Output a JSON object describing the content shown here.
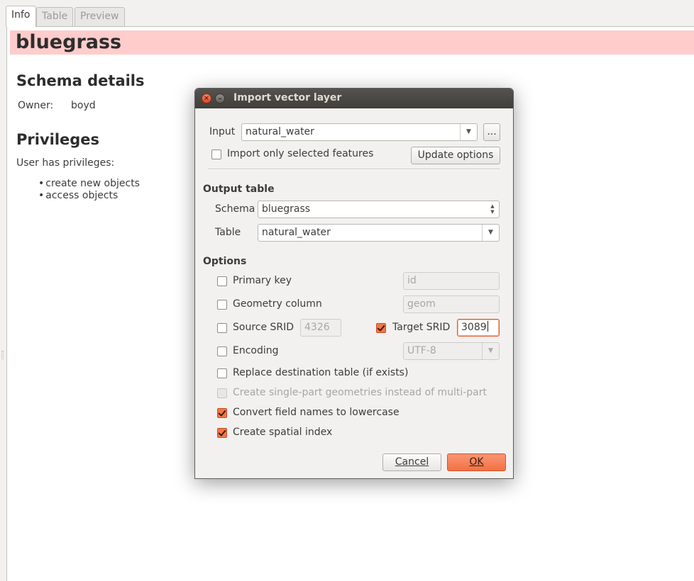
{
  "tabs": [
    {
      "label": "Info",
      "active": true
    },
    {
      "label": "Table",
      "active": false
    },
    {
      "label": "Preview",
      "active": false
    }
  ],
  "page": {
    "layer_title": "bluegrass",
    "schema_heading": "Schema details",
    "owner_label": "Owner:",
    "owner_value": "boyd",
    "privileges_heading": "Privileges",
    "privileges_intro": "User has privileges:",
    "privileges": [
      "create new objects",
      "access objects"
    ]
  },
  "dialog": {
    "title": "Import vector layer",
    "input_label": "Input",
    "input_value": "natural_water",
    "browse_label": "...",
    "import_selected_label": "Import only selected features",
    "import_selected_checked": false,
    "update_options_label": "Update options",
    "output_heading": "Output table",
    "schema_label": "Schema",
    "schema_value": "bluegrass",
    "table_label": "Table",
    "table_value": "natural_water",
    "options_heading": "Options",
    "primary_key_label": "Primary key",
    "primary_key_checked": false,
    "primary_key_value": "id",
    "geometry_column_label": "Geometry column",
    "geometry_column_checked": false,
    "geometry_column_value": "geom",
    "source_srid_label": "Source SRID",
    "source_srid_checked": false,
    "source_srid_value": "4326",
    "target_srid_label": "Target SRID",
    "target_srid_checked": true,
    "target_srid_value": "3089",
    "encoding_label": "Encoding",
    "encoding_checked": false,
    "encoding_value": "UTF-8",
    "replace_label": "Replace destination table (if exists)",
    "replace_checked": false,
    "single_part_label": "Create single-part geometries instead of multi-part",
    "single_part_checked": false,
    "lowercase_label": "Convert field names to lowercase",
    "lowercase_checked": true,
    "spatial_index_label": "Create spatial index",
    "spatial_index_checked": true,
    "cancel_label": "Cancel",
    "ok_label": "OK"
  },
  "colors": {
    "accent": "#f07746",
    "title_highlight": "#ffcccc"
  },
  "icons": [
    "close-icon",
    "minimize-icon",
    "dropdown-arrow-icon",
    "spin-arrows-icon",
    "checkmark-icon"
  ]
}
